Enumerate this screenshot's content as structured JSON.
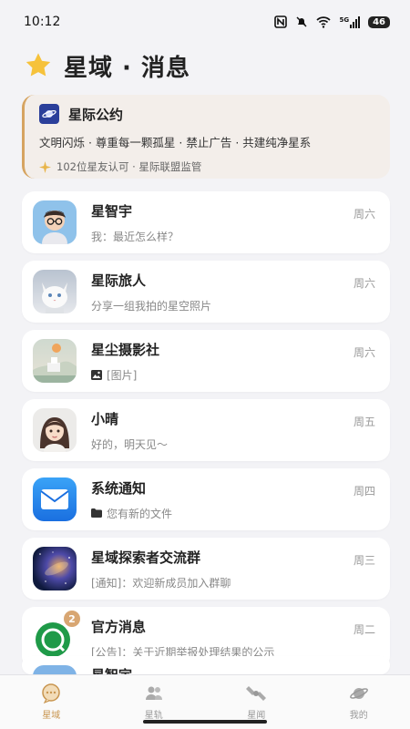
{
  "status": {
    "time": "10:12",
    "battery": "46",
    "net": "5G"
  },
  "header": {
    "title": "星域 · 消息"
  },
  "notice": {
    "title": "星际公约",
    "body": "文明闪烁 · 尊重每一颗孤星 · 禁止广告 · 共建纯净星系",
    "footer": "102位星友认可 · 星际联盟监管"
  },
  "conversations": [
    {
      "name": "星智宇",
      "message": "我：最近怎么样？",
      "day": "周六"
    },
    {
      "name": "星际旅人",
      "message": "分享一组我拍的星空照片",
      "day": "周六"
    },
    {
      "name": "星尘摄影社",
      "message": "[图片]",
      "day": "周六"
    },
    {
      "name": "小晴",
      "message": "好的，明天见～",
      "day": "周五"
    },
    {
      "name": "系统通知",
      "message": "您有新的文件",
      "day": "周四"
    },
    {
      "name": "星域探索者交流群",
      "message": "[通知]：欢迎新成员加入群聊",
      "day": "周三"
    },
    {
      "name": "官方消息",
      "message": "[公告]：关于近期举报处理结果的公示",
      "day": "周二",
      "badge": "2"
    },
    {
      "name": "星智宇",
      "message": "",
      "day": ""
    }
  ],
  "tabs": [
    {
      "label": "星域",
      "active": true
    },
    {
      "label": "星轨",
      "active": false
    },
    {
      "label": "星闻",
      "active": false
    },
    {
      "label": "我的",
      "active": false
    }
  ],
  "colors": {
    "accent": "#c8954f",
    "notice_bg": "#f3eeea",
    "badge": "#d8a672"
  }
}
